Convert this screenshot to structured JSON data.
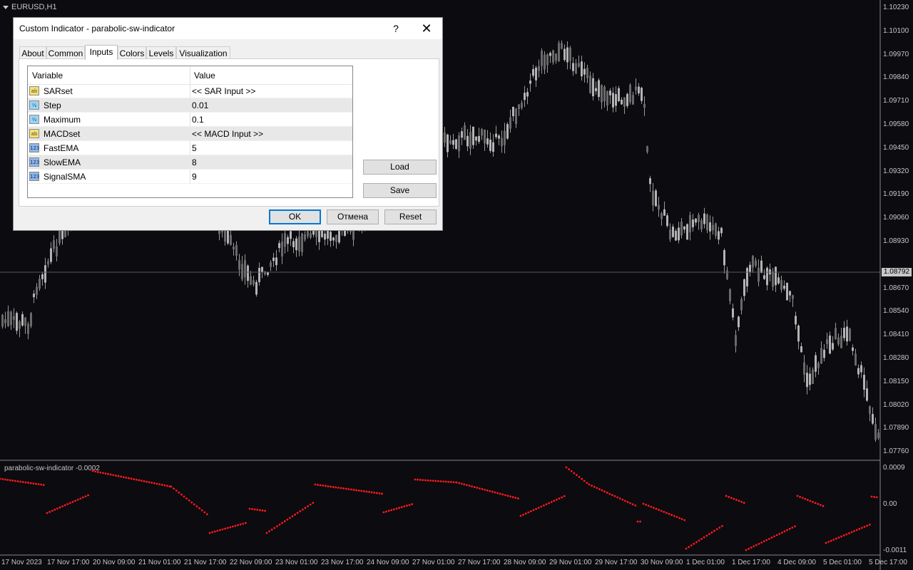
{
  "chart": {
    "symbol": "EURUSD,H1",
    "indicator_label": "parabolic-sw-indicator -0.0002",
    "current_price": "1.08792",
    "price_axis": [
      "1.10230",
      "1.10100",
      "1.09970",
      "1.09840",
      "1.09710",
      "1.09580",
      "1.09450",
      "1.09320",
      "1.09190",
      "1.09060",
      "1.08930",
      "1.08670",
      "1.08540",
      "1.08410",
      "1.08280",
      "1.08150",
      "1.08020",
      "1.07890",
      "1.07760"
    ],
    "indicator_axis": [
      "0.0009",
      "0.00",
      "-0.0011"
    ],
    "time_axis": [
      "17 Nov 2023",
      "17 Nov 17:00",
      "20 Nov 09:00",
      "21 Nov 01:00",
      "21 Nov 17:00",
      "22 Nov 09:00",
      "23 Nov 01:00",
      "23 Nov 17:00",
      "24 Nov 09:00",
      "27 Nov 01:00",
      "27 Nov 17:00",
      "28 Nov 09:00",
      "29 Nov 01:00",
      "29 Nov 17:00",
      "30 Nov 09:00",
      "1 Dec 01:00",
      "1 Dec 17:00",
      "4 Dec 09:00",
      "5 Dec 01:00",
      "5 Dec 17:00"
    ],
    "colors": {
      "background": "#0b0b10",
      "candle": "#b4b4b4",
      "indicator_dots": "#ff1a1a",
      "text": "#c8c8c8"
    }
  },
  "dialog": {
    "title": "Custom Indicator - parabolic-sw-indicator",
    "help_label": "?",
    "close_label": "✕",
    "tabs": [
      "About",
      "Common",
      "Inputs",
      "Colors",
      "Levels",
      "Visualization"
    ],
    "active_tab": "Inputs",
    "columns": {
      "variable": "Variable",
      "value": "Value"
    },
    "rows": [
      {
        "icon": "string-icon",
        "variable": "SARset",
        "value": "<< SAR Input >>"
      },
      {
        "icon": "double-icon",
        "variable": "Step",
        "value": "0.01"
      },
      {
        "icon": "double-icon",
        "variable": "Maximum",
        "value": "0.1"
      },
      {
        "icon": "string-icon",
        "variable": "MACDset",
        "value": "<< MACD Input >>"
      },
      {
        "icon": "integer-icon",
        "variable": "FastEMA",
        "value": "5"
      },
      {
        "icon": "integer-icon",
        "variable": "SlowEMA",
        "value": "8"
      },
      {
        "icon": "integer-icon",
        "variable": "SignalSMA",
        "value": "9"
      }
    ],
    "buttons": {
      "load": "Load",
      "save": "Save",
      "ok": "OK",
      "cancel": "Отмена",
      "reset": "Reset"
    }
  }
}
